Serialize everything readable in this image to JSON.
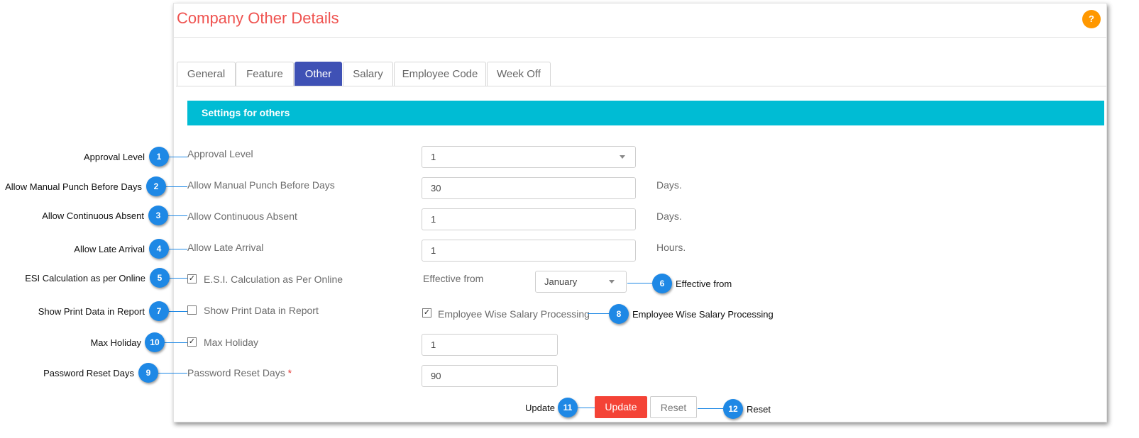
{
  "page": {
    "title": "Company Other Details",
    "help_label": "?"
  },
  "tabs": [
    {
      "label": "General",
      "active": false
    },
    {
      "label": "Feature",
      "active": false
    },
    {
      "label": "Other",
      "active": true
    },
    {
      "label": "Salary",
      "active": false
    },
    {
      "label": "Employee Code",
      "active": false
    },
    {
      "label": "Week Off",
      "active": false
    }
  ],
  "section": {
    "header": "Settings for others"
  },
  "fields": {
    "approval_level": {
      "label": "Approval Level",
      "value": "1"
    },
    "manual_punch": {
      "label": "Allow Manual Punch Before Days",
      "value": "30",
      "unit": "Days."
    },
    "continuous_absent": {
      "label": "Allow Continuous Absent",
      "value": "1",
      "unit": "Days."
    },
    "late_arrival": {
      "label": "Allow Late Arrival",
      "value": "1",
      "unit": "Hours."
    },
    "esi": {
      "label": "E.S.I. Calculation as Per Online",
      "checked": true,
      "check_mark": "✓"
    },
    "effective_from": {
      "label": "Effective from",
      "value": "January"
    },
    "show_print": {
      "label": "Show Print Data in Report",
      "checked": false,
      "check_mark": ""
    },
    "employee_wise": {
      "label": "Employee Wise Salary Processing",
      "checked": true,
      "check_mark": "✓"
    },
    "max_holiday": {
      "label": "Max Holiday",
      "checked": true,
      "check_mark": "✓",
      "value": "1"
    },
    "password_reset": {
      "label": "Password Reset Days",
      "required_mark": "*",
      "value": "90"
    }
  },
  "buttons": {
    "update": "Update",
    "reset": "Reset"
  },
  "annotations": [
    {
      "num": "1",
      "text": "Approval Level"
    },
    {
      "num": "2",
      "text": "Allow Manual Punch Before Days"
    },
    {
      "num": "3",
      "text": "Allow Continuous Absent"
    },
    {
      "num": "4",
      "text": "Allow Late Arrival"
    },
    {
      "num": "5",
      "text": "ESI Calculation as per Online"
    },
    {
      "num": "6",
      "text": "Effective from"
    },
    {
      "num": "7",
      "text": "Show Print Data in Report"
    },
    {
      "num": "8",
      "text": "Employee Wise Salary Processing"
    },
    {
      "num": "9",
      "text": "Password Reset Days"
    },
    {
      "num": "10",
      "text": "Max Holiday"
    },
    {
      "num": "11",
      "text": "Update"
    },
    {
      "num": "12",
      "text": "Reset"
    }
  ],
  "colors": {
    "title": "#ef5350",
    "tab_active": "#3f51b5",
    "banner": "#00bcd4",
    "update_button": "#f44336",
    "badge": "#1e88e5",
    "help": "#ff9800"
  }
}
